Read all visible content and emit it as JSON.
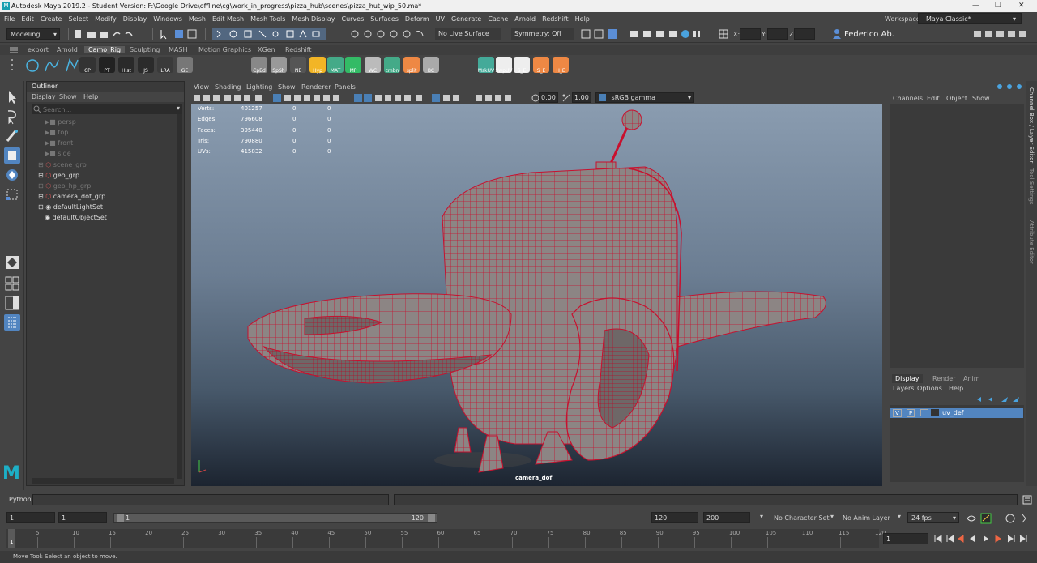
{
  "window": {
    "title": "Autodesk Maya 2019.2 - Student Version: F:\\Google Drive\\offline\\cg\\work_in_progress\\pizza_hub\\scenes\\pizza_hut_wip_50.ma*"
  },
  "menus": [
    "File",
    "Edit",
    "Create",
    "Select",
    "Modify",
    "Display",
    "Windows",
    "Mesh",
    "Edit Mesh",
    "Mesh Tools",
    "Mesh Display",
    "Curves",
    "Surfaces",
    "Deform",
    "UV",
    "Generate",
    "Cache",
    "Arnold",
    "Redshift",
    "Help"
  ],
  "workspace": {
    "label": "Workspace :",
    "value": "Maya Classic*"
  },
  "status": {
    "mode": "Modeling",
    "live_surface": "No Live Surface",
    "symmetry": "Symmetry: Off",
    "x_label": "X:",
    "y_label": "Y:",
    "z_label": "Z:",
    "user": "Federico Ab."
  },
  "shelf_tabs": [
    "export",
    "Arnold",
    "Camo_Rig",
    "Sculpting",
    "MASH",
    "Motion Graphics",
    "XGen",
    "Redshift"
  ],
  "shelf_icons": [
    {
      "label": "CP",
      "icon": "cp-icon"
    },
    {
      "label": "PT",
      "icon": "pt-icon"
    },
    {
      "label": "Hist",
      "icon": "hist-icon"
    },
    {
      "label": "JS",
      "icon": "js-icon"
    },
    {
      "label": "LRA",
      "icon": "lra-icon"
    },
    {
      "label": "GE",
      "icon": "ge-icon"
    },
    {
      "label": "CpEd",
      "icon": "cped-icon"
    },
    {
      "label": "SpSh",
      "icon": "spsh-icon"
    },
    {
      "label": "NE",
      "icon": "ne-icon"
    },
    {
      "label": "Hyp",
      "icon": "hyp-icon"
    },
    {
      "label": "MAT",
      "icon": "mat-icon"
    },
    {
      "label": "MP",
      "icon": "mp-icon"
    },
    {
      "label": "WC",
      "icon": "wc-icon"
    },
    {
      "label": "cmbn",
      "icon": "combine-icon"
    },
    {
      "label": "split",
      "icon": "split-icon"
    },
    {
      "label": "BC",
      "icon": "bc-icon"
    },
    {
      "label": "MskUV",
      "icon": "mskuv-icon"
    },
    {
      "label": "SwpUV",
      "icon": "swpuv-icon"
    },
    {
      "label": "S_E",
      "icon": "s-e-icon"
    },
    {
      "label": "S_E",
      "icon": "s-e2-icon"
    },
    {
      "label": "H_E",
      "icon": "h-e-icon"
    }
  ],
  "outliner": {
    "title": "Outliner",
    "menu": [
      "Display",
      "Show",
      "Help"
    ],
    "search_placeholder": "Search...",
    "items": [
      "persp",
      "top",
      "front",
      "side",
      "scene_grp",
      "geo_grp",
      "geo_hp_grp",
      "camera_dof_grp",
      "defaultLightSet",
      "defaultObjectSet"
    ]
  },
  "viewport": {
    "menu": [
      "View",
      "Shading",
      "Lighting",
      "Show",
      "Renderer",
      "Panels"
    ],
    "exposure": "0.00",
    "gamma": "1.00",
    "color_space": "sRGB gamma",
    "camera": "camera_dof",
    "hud": {
      "labels": [
        "Verts:",
        "Edges:",
        "Faces:",
        "Tris:",
        "UVs:"
      ],
      "values": [
        "401257",
        "796608",
        "395440",
        "790880",
        "415832"
      ],
      "sel": [
        "0",
        "0",
        "0",
        "0",
        "0"
      ],
      "comp": [
        "0",
        "0",
        "0",
        "0",
        "0"
      ]
    }
  },
  "channelbox": {
    "menu": [
      "Channels",
      "Edit",
      "Object",
      "Show"
    ],
    "side_tabs": [
      "Channel Box / Layer Editor",
      "Tool Settings",
      "Attribute Editor"
    ]
  },
  "layers": {
    "tabs": [
      "Display",
      "Render",
      "Anim"
    ],
    "menu": [
      "Layers",
      "Options",
      "Help"
    ],
    "layer": {
      "v": "V",
      "p": "P",
      "name": "uv_def"
    }
  },
  "command": {
    "label": "Python"
  },
  "range": {
    "start": "1",
    "start2": "1",
    "slider_start": "1",
    "slider_end": "120",
    "end": "120",
    "end2": "200",
    "char_set": "No Character Set",
    "anim_layer": "No Anim Layer",
    "fps": "24 fps"
  },
  "timeline": {
    "ticks": [
      "1",
      "5",
      "10",
      "15",
      "20",
      "25",
      "30",
      "35",
      "40",
      "45",
      "50",
      "55",
      "60",
      "65",
      "70",
      "75",
      "80",
      "85",
      "90",
      "95",
      "100",
      "105",
      "110",
      "115",
      "120"
    ],
    "current": "1"
  },
  "help": {
    "text": "Move Tool: Select an object to move."
  },
  "colors": {
    "accent": "#4a7fb5",
    "wire": "#c8102e",
    "layer_row": "#5285c0"
  }
}
